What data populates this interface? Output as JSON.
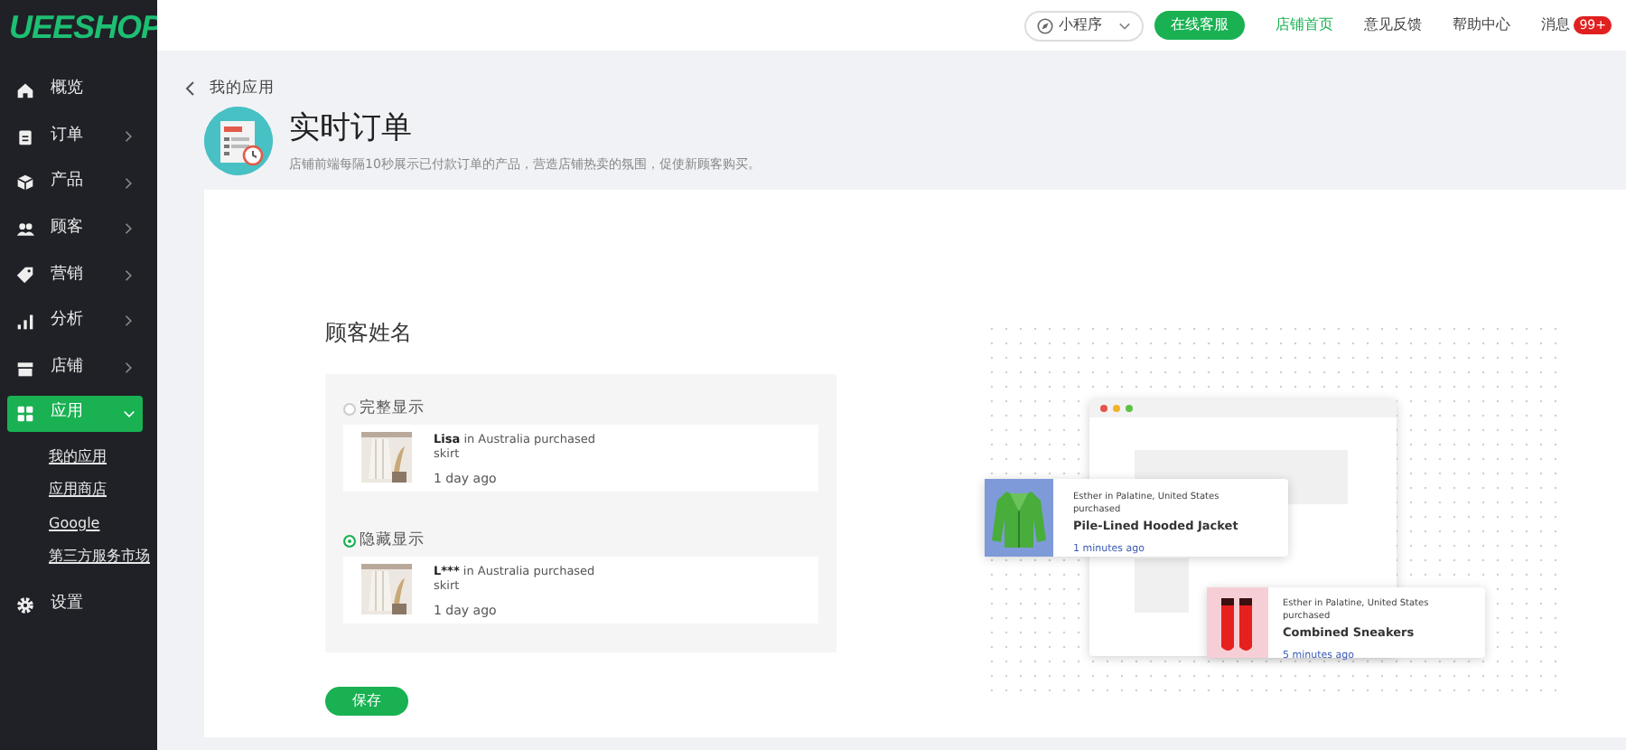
{
  "logo": "UEESHOP",
  "topbar": {
    "mini_program": "小程序",
    "support_button": "在线客服",
    "links": [
      {
        "label": "店铺首页",
        "selected": true
      },
      {
        "label": "意见反馈",
        "selected": false
      },
      {
        "label": "帮助中心",
        "selected": false
      }
    ],
    "messages": {
      "label": "消息",
      "badge": "99+"
    }
  },
  "sidebar": {
    "items": [
      {
        "label": "概览",
        "expandable": false,
        "expanded": false,
        "selected": false
      },
      {
        "label": "订单",
        "expandable": true,
        "expanded": false,
        "selected": false
      },
      {
        "label": "产品",
        "expandable": true,
        "expanded": false,
        "selected": false
      },
      {
        "label": "顾客",
        "expandable": true,
        "expanded": false,
        "selected": false
      },
      {
        "label": "营销",
        "expandable": true,
        "expanded": false,
        "selected": false
      },
      {
        "label": "分析",
        "expandable": true,
        "expanded": false,
        "selected": false
      },
      {
        "label": "店铺",
        "expandable": true,
        "expanded": false,
        "selected": false
      },
      {
        "label": "应用",
        "expandable": true,
        "expanded": true,
        "selected": true,
        "children": [
          {
            "label": "我的应用"
          },
          {
            "label": "应用商店"
          },
          {
            "label": "Google"
          },
          {
            "label": "第三方服务市场"
          }
        ]
      },
      {
        "label": "设置",
        "expandable": false,
        "expanded": false,
        "selected": false
      }
    ]
  },
  "breadcrumb": "我的应用",
  "header": {
    "title": "实时订单",
    "description": "店铺前端每隔10秒展示已付款订单的产品，营造店铺热卖的氛围，促使新顾客购买。"
  },
  "section_title": "顾客姓名",
  "options": [
    {
      "label": "完整显示",
      "selected": false,
      "preview": {
        "name": "Lisa",
        "text": " in Australia purchased",
        "product": "skirt",
        "time": "1 day ago"
      }
    },
    {
      "label": "隐藏显示",
      "selected": true,
      "preview": {
        "name": "L***",
        "text": " in Australia purchased",
        "product": "skirt",
        "time": "1 day ago"
      }
    }
  ],
  "save_button": "保存",
  "illustration": {
    "notifications": [
      {
        "buyer": "Esther in Palatine, United States purchased",
        "product": "Pile-Lined Hooded Jacket",
        "time": "1 minutes ago"
      },
      {
        "buyer": "Esther in Palatine, United States purchased",
        "product": "Combined Sneakers",
        "time": "5 minutes ago"
      }
    ]
  }
}
